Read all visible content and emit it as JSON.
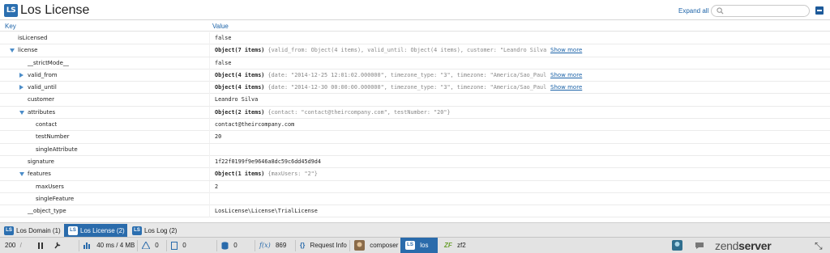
{
  "header": {
    "logo_text": "LS",
    "title": "Los License",
    "expand_all": "Expand all",
    "search_placeholder": ""
  },
  "columns": {
    "key": "Key",
    "value": "Value"
  },
  "rows": [
    {
      "key": "isLicensed",
      "indent": 0,
      "toggle": "none",
      "value": "false",
      "value_bold": "",
      "preview": "",
      "show_more": ""
    },
    {
      "key": "license",
      "indent": 0,
      "toggle": "down",
      "value": "",
      "value_bold": "Object(7 items)",
      "preview": " {valid_from: Object(4 items), valid_until: Object(4 items), customer: \"Leandro Silva",
      "show_more": "Show more"
    },
    {
      "key": "__strictMode__",
      "indent": 1,
      "toggle": "none",
      "value": "false",
      "value_bold": "",
      "preview": "",
      "show_more": ""
    },
    {
      "key": "valid_from",
      "indent": 1,
      "toggle": "right",
      "value": "",
      "value_bold": "Object(4 items)",
      "preview": " {date: \"2014-12-25 12:01:02.000000\", timezone_type: \"3\", timezone: \"America/Sao_Paul",
      "show_more": "Show more"
    },
    {
      "key": "valid_until",
      "indent": 1,
      "toggle": "right",
      "value": "",
      "value_bold": "Object(4 items)",
      "preview": " {date: \"2014-12-30 00:00:00.000000\", timezone_type: \"3\", timezone: \"America/Sao_Paul",
      "show_more": "Show more"
    },
    {
      "key": "customer",
      "indent": 1,
      "toggle": "none",
      "value": "Leandro Silva",
      "value_bold": "",
      "preview": "",
      "show_more": ""
    },
    {
      "key": "attributes",
      "indent": 1,
      "toggle": "down",
      "value": "",
      "value_bold": "Object(2 items)",
      "preview": " {contact: \"contact@theircompany.com\", testNumber: \"20\"}",
      "show_more": ""
    },
    {
      "key": "contact",
      "indent": 2,
      "toggle": "none",
      "value": "contact@theircompany.com",
      "value_bold": "",
      "preview": "",
      "show_more": ""
    },
    {
      "key": "testNumber",
      "indent": 2,
      "toggle": "none",
      "value": "20",
      "value_bold": "",
      "preview": "",
      "show_more": ""
    },
    {
      "key": "singleAttribute",
      "indent": 2,
      "toggle": "none",
      "value": "",
      "value_bold": "",
      "preview": "",
      "show_more": ""
    },
    {
      "key": "signature",
      "indent": 1,
      "toggle": "none",
      "value": "1f22f0199f9e9646a8dc59c6dd45d9d4",
      "value_bold": "",
      "preview": "",
      "show_more": ""
    },
    {
      "key": "features",
      "indent": 1,
      "toggle": "down",
      "value": "",
      "value_bold": "Object(1 items)",
      "preview": " {maxUsers: \"2\"}",
      "show_more": ""
    },
    {
      "key": "maxUsers",
      "indent": 2,
      "toggle": "none",
      "value": "2",
      "value_bold": "",
      "preview": "",
      "show_more": ""
    },
    {
      "key": "singleFeature",
      "indent": 2,
      "toggle": "none",
      "value": "",
      "value_bold": "",
      "preview": "",
      "show_more": ""
    },
    {
      "key": "__object_type",
      "indent": 1,
      "toggle": "none",
      "value": "LosLicense\\License\\TrialLicense",
      "value_bold": "",
      "preview": "",
      "show_more": ""
    }
  ],
  "tabs": [
    {
      "label": "Los Domain (1)",
      "icon": "LS",
      "active": false
    },
    {
      "label": "Los License (2)",
      "icon": "LS",
      "active": true
    },
    {
      "label": "Los Log (2)",
      "icon": "LS",
      "active": false
    }
  ],
  "toolbar": {
    "status_code": "200",
    "status_slash": "/",
    "timing": "40 ms / 4 MB",
    "warnings": "0",
    "events": "0",
    "db_queries": "0",
    "functions": "869",
    "request_info": "Request Info",
    "composer": "composer",
    "los": "los",
    "zf2": "zf2",
    "brand_prefix": "zend",
    "brand_suffix": "server"
  },
  "colors": {
    "accent": "#2a6bab",
    "link": "#1c63a8",
    "triangle": "#4b8cc8"
  }
}
